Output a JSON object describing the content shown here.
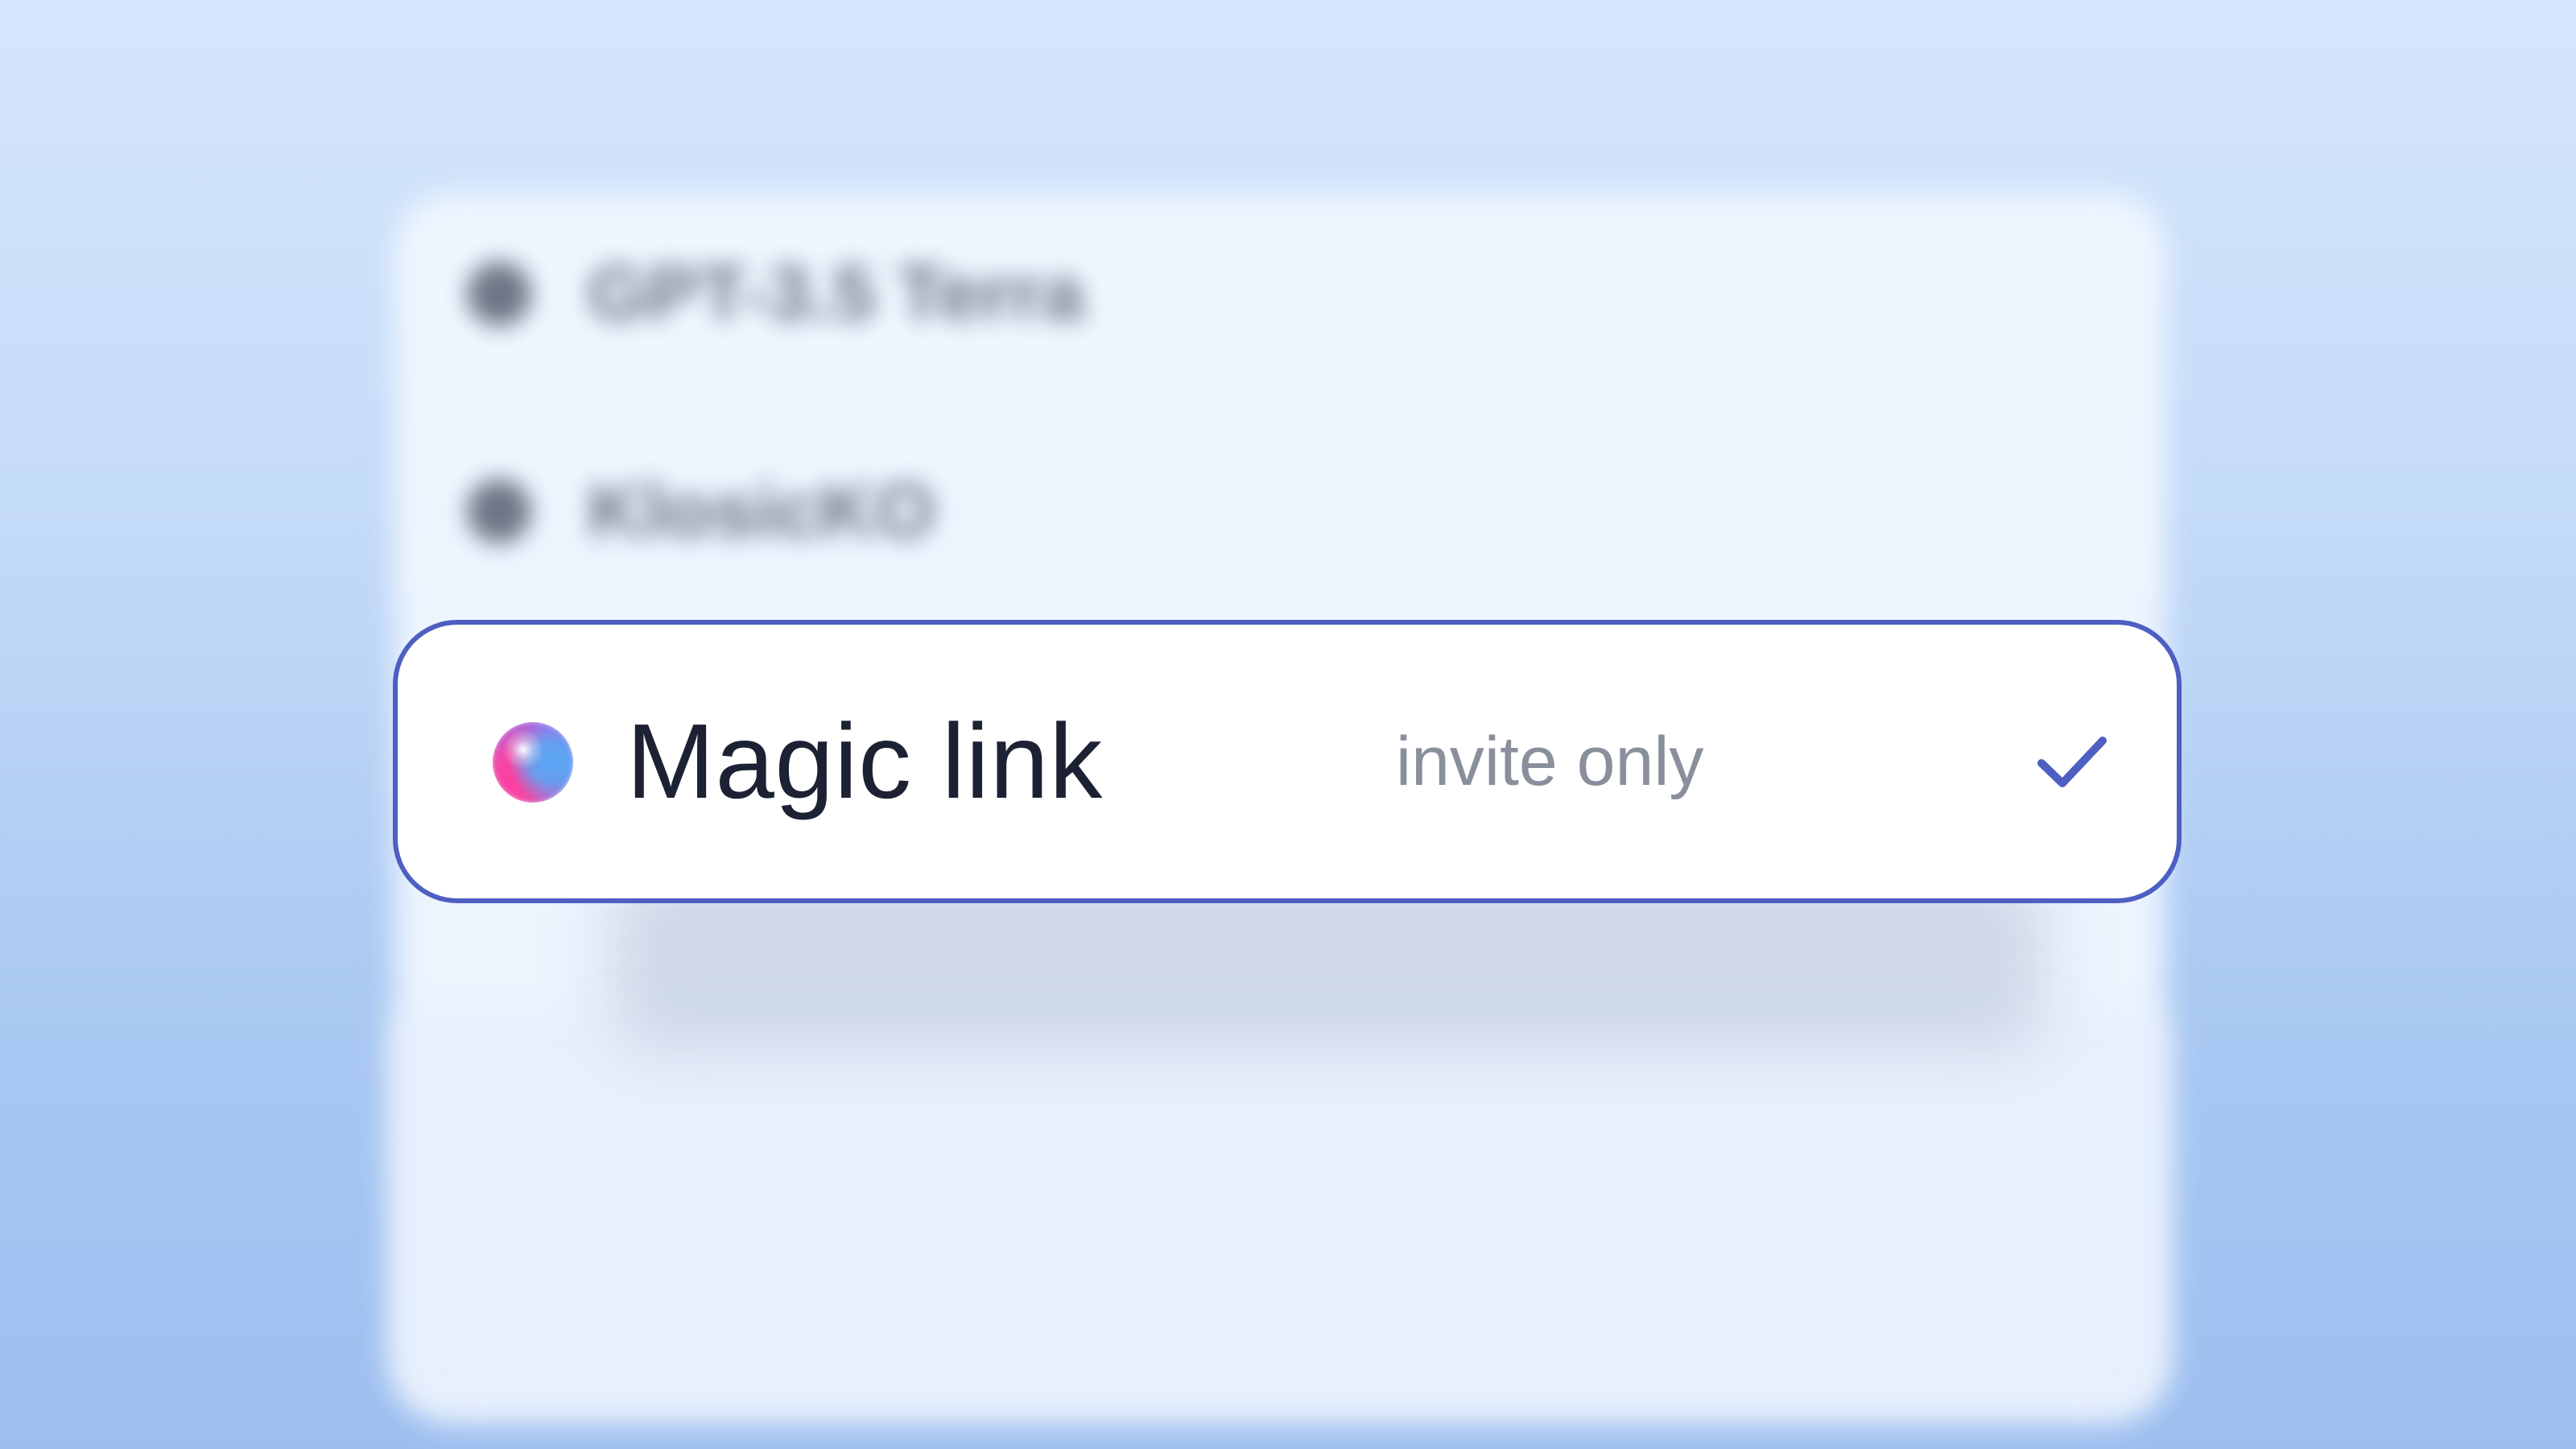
{
  "background_list": {
    "items": [
      {
        "label": "GPT-3.5 Terra",
        "icon": "circle-icon"
      },
      {
        "label": "KlosicKO",
        "icon": "circle-icon"
      }
    ]
  },
  "selected_option": {
    "title": "Magic link",
    "subtitle": "invite only",
    "icon": "gradient-orb-icon",
    "check_icon": "checkmark-icon",
    "selected": true
  },
  "colors": {
    "accent": "#4d5fc1",
    "background_top": "#d5e6fc",
    "background_bottom": "#9dbff0",
    "title_text": "#1c2233",
    "subtitle_text": "#8a8f9c"
  }
}
